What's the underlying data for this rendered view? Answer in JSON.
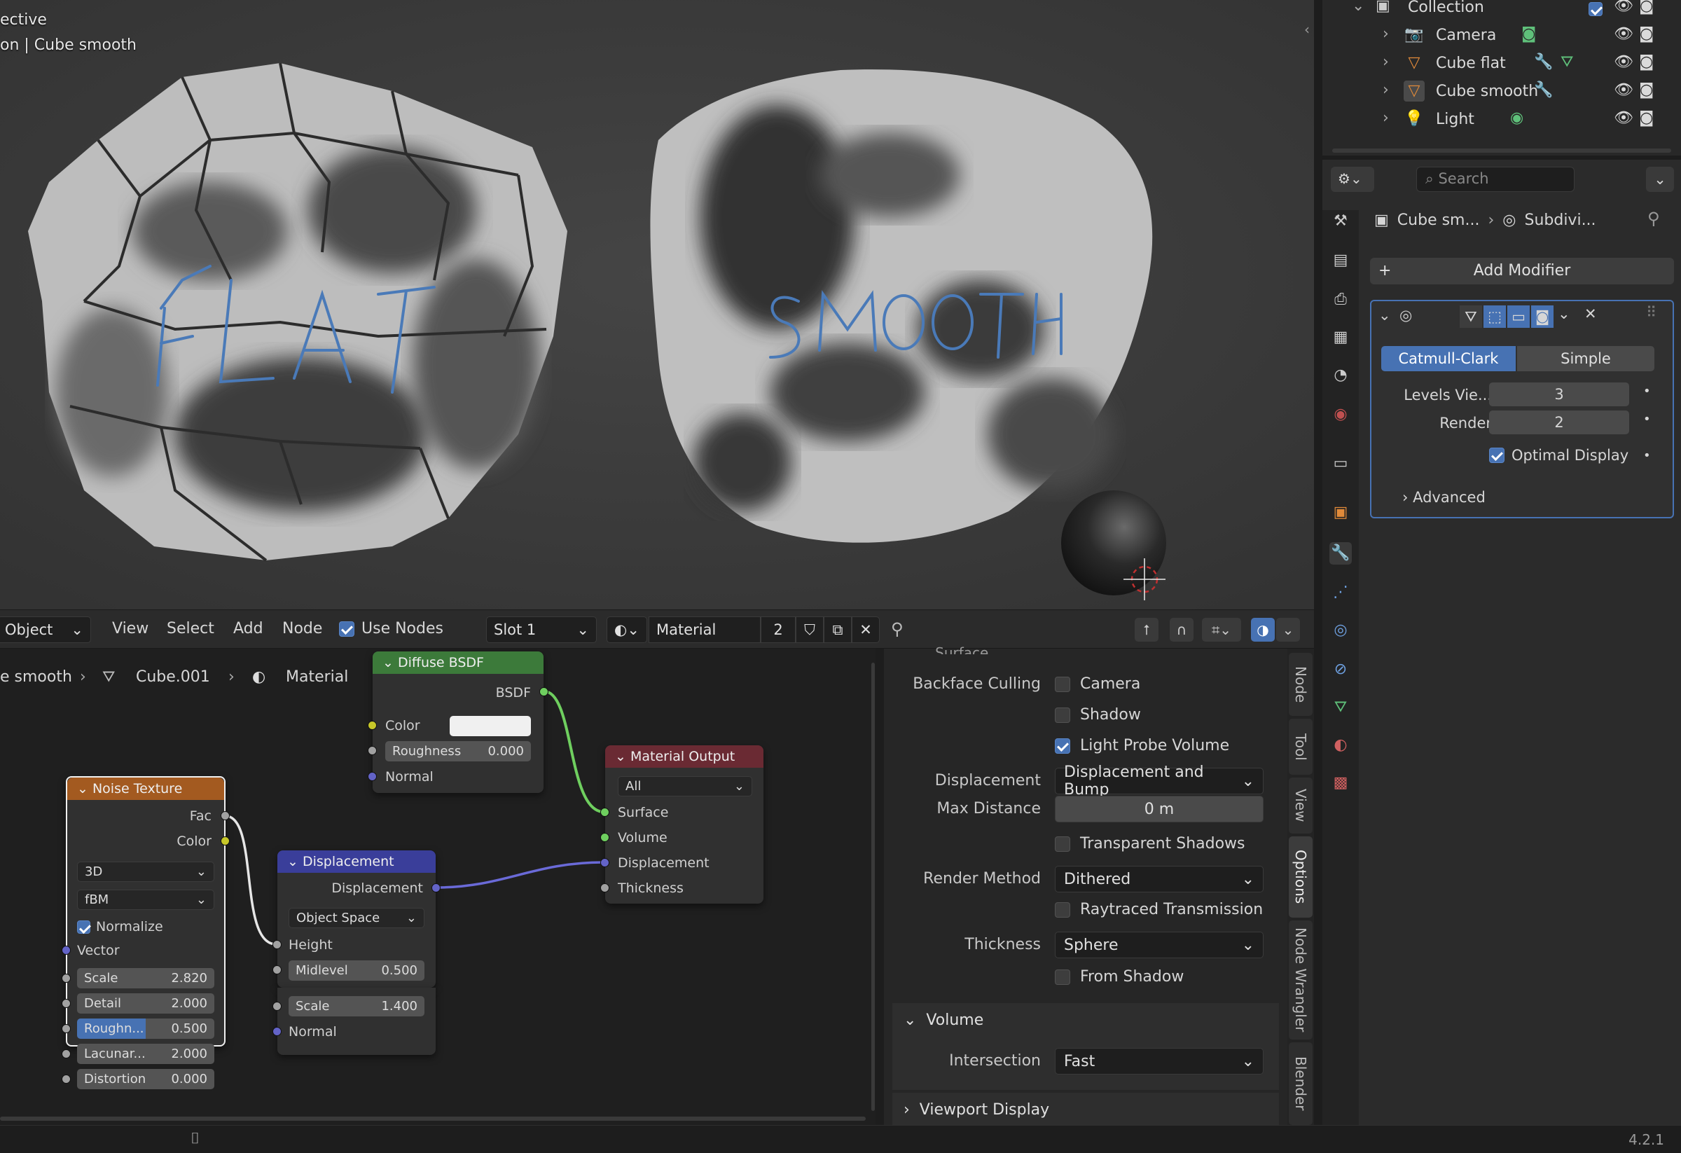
{
  "viewport": {
    "mode_label": "ective",
    "object_label": "on | Cube smooth",
    "flat_text": "FLAT",
    "smooth_text": "SMOOTH"
  },
  "node_header": {
    "editor_mode": "Object",
    "menus": [
      "View",
      "Select",
      "Add",
      "Node"
    ],
    "use_nodes_label": "Use Nodes",
    "use_nodes_checked": true,
    "slot": "Slot 1",
    "material_name": "Material",
    "material_users": "2"
  },
  "node_breadcrumb": {
    "object": "e smooth",
    "mesh": "Cube.001",
    "material": "Material"
  },
  "nodes": {
    "diffuse": {
      "title": "Diffuse BSDF",
      "out_bsdf": "BSDF",
      "color_label": "Color",
      "roughness_label": "Roughness",
      "roughness_value": "0.000",
      "normal_label": "Normal"
    },
    "output": {
      "title": "Material Output",
      "target": "All",
      "surface": "Surface",
      "volume": "Volume",
      "displacement": "Displacement",
      "thickness": "Thickness"
    },
    "noise": {
      "title": "Noise Texture",
      "out_fac": "Fac",
      "out_color": "Color",
      "dimensions": "3D",
      "type": "fBM",
      "normalize_label": "Normalize",
      "vector_label": "Vector",
      "fields": [
        {
          "label": "Scale",
          "value": "2.820"
        },
        {
          "label": "Detail",
          "value": "2.000"
        },
        {
          "label": "Roughn...",
          "value": "0.500",
          "fill": 0.5
        },
        {
          "label": "Lacunar...",
          "value": "2.000"
        },
        {
          "label": "Distortion",
          "value": "0.000"
        }
      ]
    },
    "displacement": {
      "title": "Displacement",
      "out_disp": "Displacement",
      "space": "Object Space",
      "height_label": "Height",
      "midlevel_label": "Midlevel",
      "midlevel_value": "0.500",
      "scale_label": "Scale",
      "scale_value": "1.400",
      "normal_label": "Normal"
    }
  },
  "options": {
    "section_top": "Surface",
    "backface_label": "Backface Culling",
    "camera_label": "Camera",
    "shadow_label": "Shadow",
    "light_probe_label": "Light Probe Volume",
    "displacement_label": "Displacement",
    "displacement_value": "Displacement and Bump",
    "max_distance_label": "Max Distance",
    "max_distance_value": "0 m",
    "transparent_shadows_label": "Transparent Shadows",
    "render_method_label": "Render Method",
    "render_method_value": "Dithered",
    "raytraced_label": "Raytraced Transmission",
    "thickness_label": "Thickness",
    "thickness_value": "Sphere",
    "from_shadow_label": "From Shadow",
    "volume_section": "Volume",
    "intersection_label": "Intersection",
    "intersection_value": "Fast",
    "viewport_display_section": "Viewport Display"
  },
  "side_tabs": [
    "Node",
    "Tool",
    "View",
    "Options",
    "Node Wrangler",
    "Blender"
  ],
  "outliner": {
    "collection": "Collection",
    "items": [
      "Camera",
      "Cube flat",
      "Cube smooth",
      "Light"
    ]
  },
  "properties": {
    "search_placeholder": "Search",
    "crumb_object": "Cube sm...",
    "crumb_modifier": "Subdivi...",
    "add_modifier": "Add Modifier",
    "mode_catmull": "Catmull-Clark",
    "mode_simple": "Simple",
    "levels_label": "Levels Vie...",
    "levels_value": "3",
    "render_label": "Render",
    "render_value": "2",
    "optimal_label": "Optimal Display",
    "advanced_label": "Advanced"
  },
  "status": {
    "version": "4.2.1"
  },
  "colors": {
    "accent": "#4772b3",
    "diffuse_head": "#3c7a3a",
    "output_head": "#6a2a33",
    "noise_head": "#a35a20",
    "disp_head": "#3a3e9a"
  }
}
